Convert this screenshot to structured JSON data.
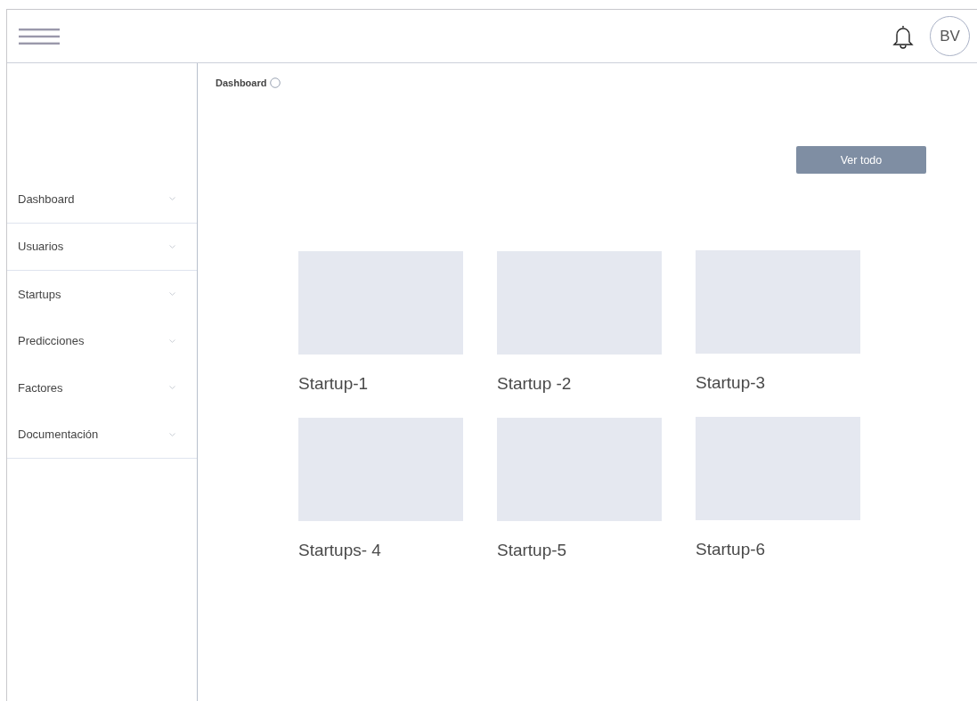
{
  "header": {
    "avatar": "BV"
  },
  "sidebar": {
    "groups": [
      [
        {
          "label": "Dashboard"
        }
      ],
      [
        {
          "label": "Usuarios"
        }
      ],
      [
        {
          "label": "Startups"
        },
        {
          "label": "Predicciones"
        },
        {
          "label": "Factores"
        },
        {
          "label": "Documentación"
        }
      ]
    ]
  },
  "breadcrumb": "Dashboard",
  "view_all_button": "Ver todo",
  "cards": [
    {
      "title": "Startup-1"
    },
    {
      "title": "Startup -2"
    },
    {
      "title": "Startup-3"
    },
    {
      "title": "Startups- 4"
    },
    {
      "title": "Startup-5"
    },
    {
      "title": "Startup-6"
    }
  ]
}
